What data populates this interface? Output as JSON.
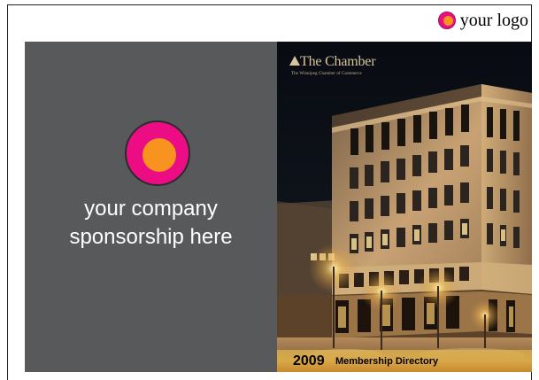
{
  "header": {
    "logo_label": "your logo",
    "logo_icon": "circle-logo-icon",
    "logo_colors": {
      "outer": "#ec0d85",
      "inner": "#f7931e"
    }
  },
  "sponsorship": {
    "line1": "your company",
    "line2": "sponsorship here",
    "background": "#58595b",
    "logo_icon": "circle-logo-icon"
  },
  "cover": {
    "brand": "The Chamber",
    "subtitle": "The Winnipeg Chamber of Commerce",
    "year": "2009",
    "directory_title": "Membership Directory"
  }
}
